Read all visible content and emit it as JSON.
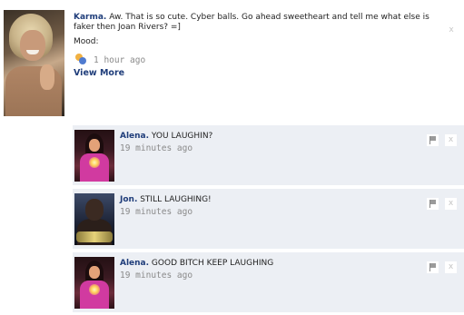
{
  "post": {
    "author": "Karma.",
    "text": " Aw. That is so cute. Cyber balls. Go ahead sweetheart and tell me what else is faker then Joan Rivers? =]",
    "mood_label": "Mood:",
    "mood_icon": "mood-icon",
    "time": "1 hour ago",
    "view_more": "View More",
    "close": "x"
  },
  "comments": [
    {
      "author": "Alena.",
      "text": " YOU LAUGHIN?",
      "time": "19 minutes ago",
      "flag_icon": "flag-icon",
      "close": "x"
    },
    {
      "author": "Jon.",
      "text": " STILL LAUGHING!",
      "time": "19 minutes ago",
      "flag_icon": "flag-icon",
      "close": "x"
    },
    {
      "author": "Alena.",
      "text": " GOOD BITCH KEEP LAUGHING",
      "time": "19 minutes ago",
      "flag_icon": "flag-icon",
      "close": "x"
    }
  ],
  "colors": {
    "author_link": "#1f3d7a",
    "comment_bg": "#eceff4",
    "timestamp": "#8a8a8a"
  }
}
